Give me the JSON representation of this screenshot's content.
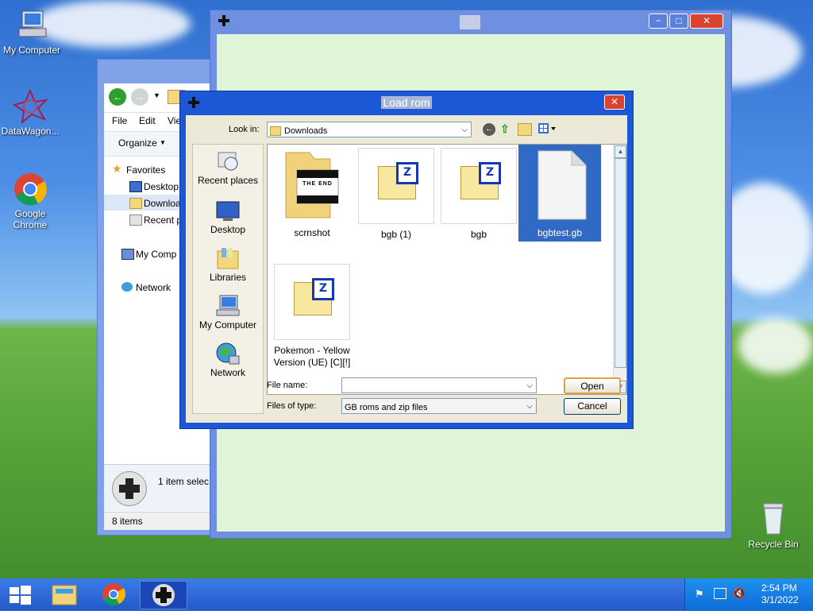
{
  "desktop": {
    "icons": [
      {
        "label": "My Computer"
      },
      {
        "label": "DataWagon..."
      },
      {
        "label": "Google Chrome"
      },
      {
        "label": "Recycle Bin"
      }
    ]
  },
  "explorer": {
    "menu": [
      "File",
      "Edit",
      "Vie"
    ],
    "organize_label": "Organize",
    "tree": [
      {
        "label": "Favorites"
      },
      {
        "label": "Desktop"
      },
      {
        "label": "Downloa"
      },
      {
        "label": "Recent p"
      },
      {
        "label": "My Comp"
      },
      {
        "label": "Network"
      }
    ],
    "details_text": "1 item selec",
    "status_items": "8 items"
  },
  "dialog": {
    "title": "Load rom",
    "look_in_label": "Look in:",
    "look_in_value": "Downloads",
    "places": [
      {
        "label": "Recent places"
      },
      {
        "label": "Desktop"
      },
      {
        "label": "Libraries"
      },
      {
        "label": "My Computer"
      },
      {
        "label": "Network"
      }
    ],
    "files": [
      {
        "name": "scrnshot",
        "thumb_text": "THE END"
      },
      {
        "name": "bgb (1)"
      },
      {
        "name": "bgb"
      },
      {
        "name": "bgbtest.gb",
        "selected": true
      },
      {
        "name": "Pokemon - Yellow Version (UE) [C][!]"
      }
    ],
    "zip_badge": "Z",
    "file_name_label": "File name:",
    "file_name_value": "",
    "file_type_label": "Files of type:",
    "file_type_value": "GB roms and zip files",
    "open_label": "Open",
    "cancel_label": "Cancel"
  },
  "taskbar": {
    "time": "2:54 PM",
    "date": "3/1/2022"
  },
  "colors": {
    "dialog_frame": "#1c57d6",
    "selection": "#316ac5",
    "emulator_client": "#dff5d7",
    "close_button": "#d9432f"
  }
}
